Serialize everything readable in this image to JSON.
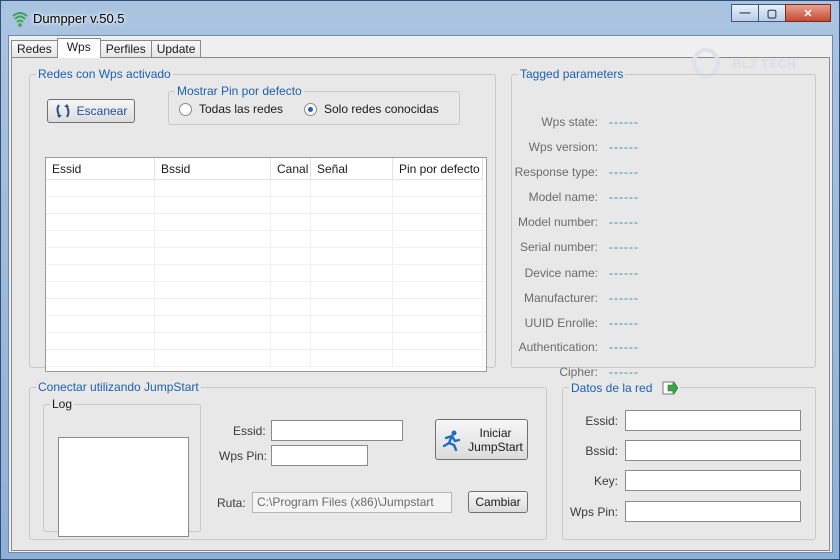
{
  "window": {
    "title": "Dumpper v.50.5",
    "buttons": {
      "minimize": "—",
      "maximize": "▢",
      "close": "✕"
    }
  },
  "tabs": [
    {
      "label": "Redes",
      "active": false
    },
    {
      "label": "Wps",
      "active": true
    },
    {
      "label": "Perfiles",
      "active": false
    },
    {
      "label": "Update",
      "active": false
    }
  ],
  "watermark": "BLZ TECH",
  "wps_networks": {
    "legend": "Redes con Wps activado",
    "scan_button": "Escanear",
    "pin_group": {
      "legend": "Mostrar Pin por defecto",
      "options": [
        {
          "label": "Todas las redes",
          "checked": false
        },
        {
          "label": "Solo redes conocidas",
          "checked": true
        }
      ]
    },
    "columns": [
      "Essid",
      "Bssid",
      "Canal",
      "Señal",
      "Pin por defecto"
    ]
  },
  "tagged": {
    "legend": "Tagged parameters",
    "params": [
      {
        "label": "Wps state:",
        "value": "------"
      },
      {
        "label": "Wps version:",
        "value": "------"
      },
      {
        "label": "Response type:",
        "value": "------"
      },
      {
        "label": "Model name:",
        "value": "------"
      },
      {
        "label": "Model number:",
        "value": "------"
      },
      {
        "label": "Serial number:",
        "value": "------"
      },
      {
        "label": "Device name:",
        "value": "------"
      },
      {
        "label": "Manufacturer:",
        "value": "------"
      },
      {
        "label": "UUID Enrolle:",
        "value": "------"
      },
      {
        "label": "Authentication:",
        "value": "------"
      },
      {
        "label": "Cipher:",
        "value": "------"
      }
    ]
  },
  "jumpstart": {
    "legend": "Conectar utilizando JumpStart",
    "log_legend": "Log",
    "essid_label": "Essid:",
    "essid_value": "",
    "wpspin_label": "Wps Pin:",
    "wpspin_value": "",
    "start_button_line1": "Iniciar",
    "start_button_line2": "JumpStart",
    "ruta_label": "Ruta:",
    "ruta_value": "C:\\Program Files (x86)\\Jumpstart",
    "change_button": "Cambiar"
  },
  "network_data": {
    "legend": "Datos de la red",
    "fields": [
      {
        "label": "Essid:",
        "value": ""
      },
      {
        "label": "Bssid:",
        "value": ""
      },
      {
        "label": "Key:",
        "value": ""
      },
      {
        "label": "Wps Pin:",
        "value": ""
      }
    ]
  }
}
